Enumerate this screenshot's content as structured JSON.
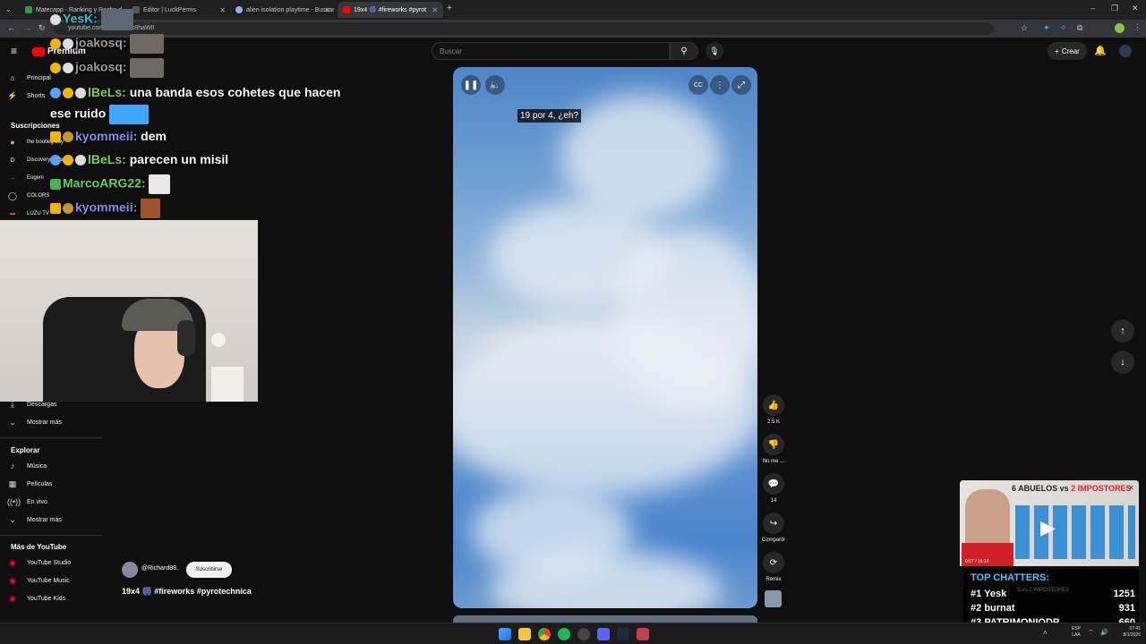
{
  "browser": {
    "tabs": [
      {
        "label": "Matecapp - Ranking y Racha d",
        "icon_color": "#2d9c4a"
      },
      {
        "label": "Editor | LuckPerms",
        "icon_color": "#555555"
      },
      {
        "label": "alien isolation playtime - Buscar",
        "icon_color": "#8ab4f8"
      },
      {
        "label": "19x4 🎆 #fireworks #pyrot",
        "icon_color": "#ff0000",
        "active": true
      }
    ],
    "url": "youtube.com/shorts/...Ix8haWII"
  },
  "youtube": {
    "logo_text": "Premium",
    "search_placeholder": "Buscar",
    "create_label": "Crear",
    "sidebar": {
      "top_items": [
        {
          "label": "Principal",
          "icon": "home-icon"
        },
        {
          "label": "Shorts",
          "icon": "shorts-icon"
        }
      ],
      "subs_header": "Suscripciones",
      "subscriptions": [
        {
          "label": "the bootleg boy"
        },
        {
          "label": "Discovery Channel"
        },
        {
          "label": "Eugeni"
        },
        {
          "label": "COLORS"
        },
        {
          "label": "LUZU TV"
        }
      ],
      "you_items": [
        {
          "label": "Descargas",
          "icon": "download-icon"
        },
        {
          "label": "Mostrar más",
          "icon": "chevron-down-icon"
        }
      ],
      "explore_header": "Explorar",
      "explore_items": [
        {
          "label": "Música",
          "icon": "music-icon"
        },
        {
          "label": "Películas",
          "icon": "film-icon"
        },
        {
          "label": "En vivo",
          "icon": "live-icon"
        },
        {
          "label": "Mostrar más",
          "icon": "chevron-down-icon"
        }
      ],
      "more_header": "Más de YouTube",
      "more_items": [
        {
          "label": "YouTube Studio"
        },
        {
          "label": "YouTube Music"
        },
        {
          "label": "YouTube Kids"
        }
      ]
    },
    "short": {
      "caption": "19 por 4, ¿eh?",
      "channel": "@Richard88.",
      "subscribe_label": "Suscribirse",
      "title": "19x4 🎆 #fireworks #pyrotechnica",
      "actions": {
        "likes": "2.5 K",
        "dislike": "No me ...",
        "comments": "14",
        "share": "Compartir",
        "remix": "Remix"
      }
    }
  },
  "chat": [
    {
      "user": "YesK:",
      "message": "",
      "color": "#28c6e0"
    },
    {
      "user": "joakosq:",
      "message": "",
      "color": "#9a9a9a"
    },
    {
      "user": "joakosq:",
      "message": "",
      "color": "#9a9a9a"
    },
    {
      "user": "lBeLs:",
      "message": "una banda esos cohetes que hacen",
      "color": "#7cd34a"
    },
    {
      "user": "",
      "message": "ese ruido",
      "color": "#ffffff"
    },
    {
      "user": "kyommeii:",
      "message": "dem",
      "color": "#8a8cf0"
    },
    {
      "user": "lBeLs:",
      "message": "parecen un misil",
      "color": "#7cd34a"
    },
    {
      "user": "MarcoARG22:",
      "message": "",
      "color": "#5cd65c"
    },
    {
      "user": "kyommeii:",
      "message": "",
      "color": "#8a8cf0"
    }
  ],
  "promo": {
    "title_a": "6 ABUELOS vs ",
    "title_b": "2 IMPOSTORES",
    "time": "0:07 / 15:14",
    "subtitle": "S vs 2 IMPOSTORES"
  },
  "top_chatters": {
    "header": "TOP CHATTERS:",
    "rows": [
      {
        "rank": "#1",
        "name": "Yesk",
        "count": "1251"
      },
      {
        "rank": "#2",
        "name": "burnat",
        "count": "931"
      },
      {
        "rank": "#3",
        "name": "PATRIMONIODP",
        "count": "660"
      }
    ]
  },
  "taskbar": {
    "lang": "ESP",
    "lang2": "LAA",
    "time": "07:41",
    "date": "8/1/2026"
  },
  "colors": {
    "yt_red": "#ff0000",
    "accent": "#3ea6ff",
    "chatter_blue": "#4fc3f7"
  }
}
